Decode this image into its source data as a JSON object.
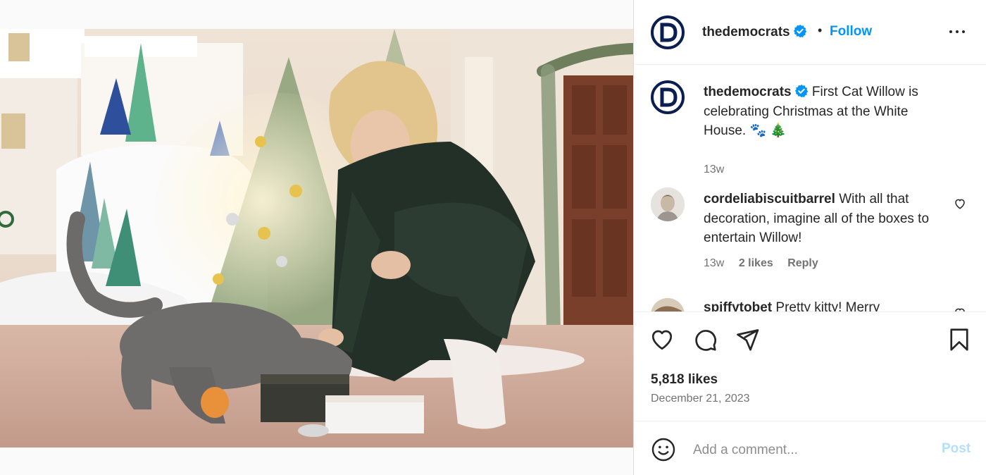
{
  "header": {
    "username": "thedemocrats",
    "separator": "•",
    "follow_label": "Follow"
  },
  "caption": {
    "username": "thedemocrats",
    "text": "First Cat Willow is celebrating Christmas at the White House. 🐾 🎄",
    "time": "13w"
  },
  "comments": [
    {
      "username": "cordeliabiscuitbarrel",
      "text": "With all that decoration, imagine all of the boxes to entertain Willow!",
      "time": "13w",
      "likes": "2 likes",
      "reply_label": "Reply"
    },
    {
      "username": "spiffytobet",
      "text": "Pretty kitty! Merry"
    }
  ],
  "post": {
    "likes": "5,818 likes",
    "date": "December 21, 2023"
  },
  "add_comment": {
    "placeholder": "Add a comment...",
    "post_label": "Post"
  },
  "icons": {
    "more": "more-options-icon",
    "verified": "verified-badge-icon",
    "like": "heart-icon",
    "comment": "comment-icon",
    "share": "share-icon",
    "save": "bookmark-icon",
    "emoji": "emoji-icon"
  },
  "colors": {
    "brand_blue": "#0095f6",
    "democrats_navy": "#0a1f4f",
    "post_disabled": "#b2dffc",
    "secondary_text": "#737373"
  }
}
